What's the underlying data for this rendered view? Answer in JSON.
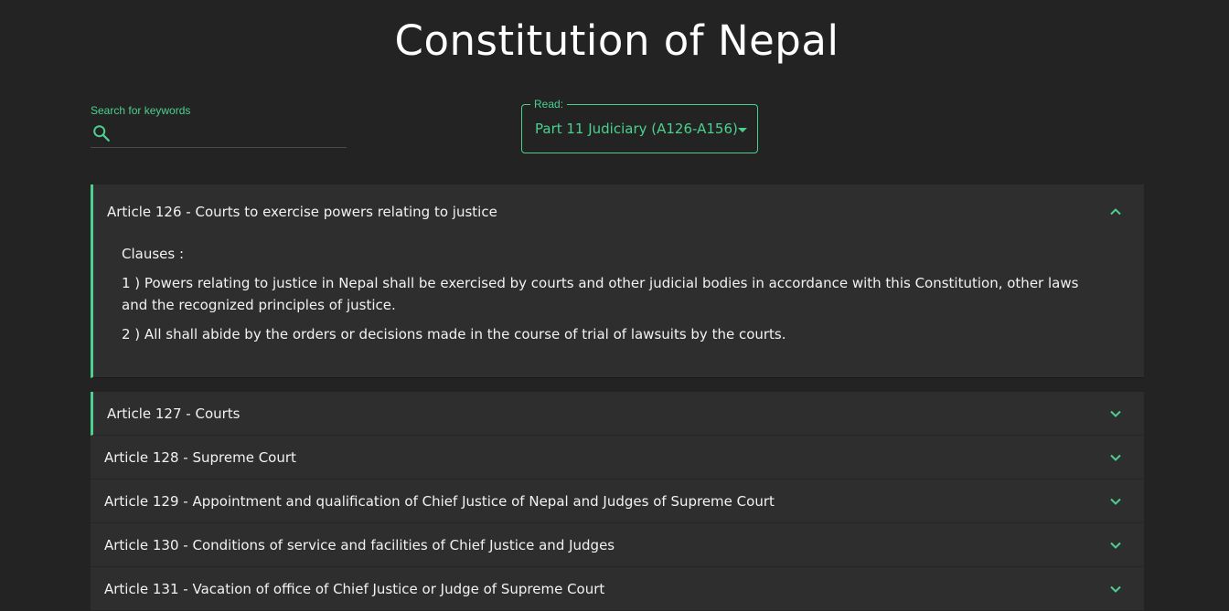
{
  "page": {
    "title": "Constitution of Nepal"
  },
  "search": {
    "label": "Search for keywords",
    "placeholder": "",
    "icon": "search-icon"
  },
  "read_select": {
    "legend": "Read:",
    "value": "Part 11 Judiciary (A126-A156)",
    "icon": "caret-down-icon"
  },
  "colors": {
    "accent": "#4cd08f",
    "background": "#232323",
    "panel": "#2e2e2e"
  },
  "articles": [
    {
      "title": "Article 126 - Courts to exercise powers relating to justice",
      "expanded": true,
      "clauses_label": "Clauses :",
      "clauses": [
        "1 ) Powers relating to justice in Nepal shall be exercised by courts and other judicial bodies in accordance with this Constitution, other laws and the recognized principles of justice.",
        "2 ) All shall abide by the orders or decisions made in the course of trial of lawsuits by the courts."
      ]
    },
    {
      "title": "Article 127 - Courts",
      "expanded": false
    },
    {
      "title": "Article 128 - Supreme Court",
      "expanded": false
    },
    {
      "title": "Article 129 - Appointment and qualification of Chief Justice of Nepal and Judges of Supreme Court",
      "expanded": false
    },
    {
      "title": "Article 130 - Conditions of service and facilities of Chief Justice and Judges",
      "expanded": false
    },
    {
      "title": "Article 131 - Vacation of office of Chief Justice or Judge of Supreme Court",
      "expanded": false
    }
  ]
}
